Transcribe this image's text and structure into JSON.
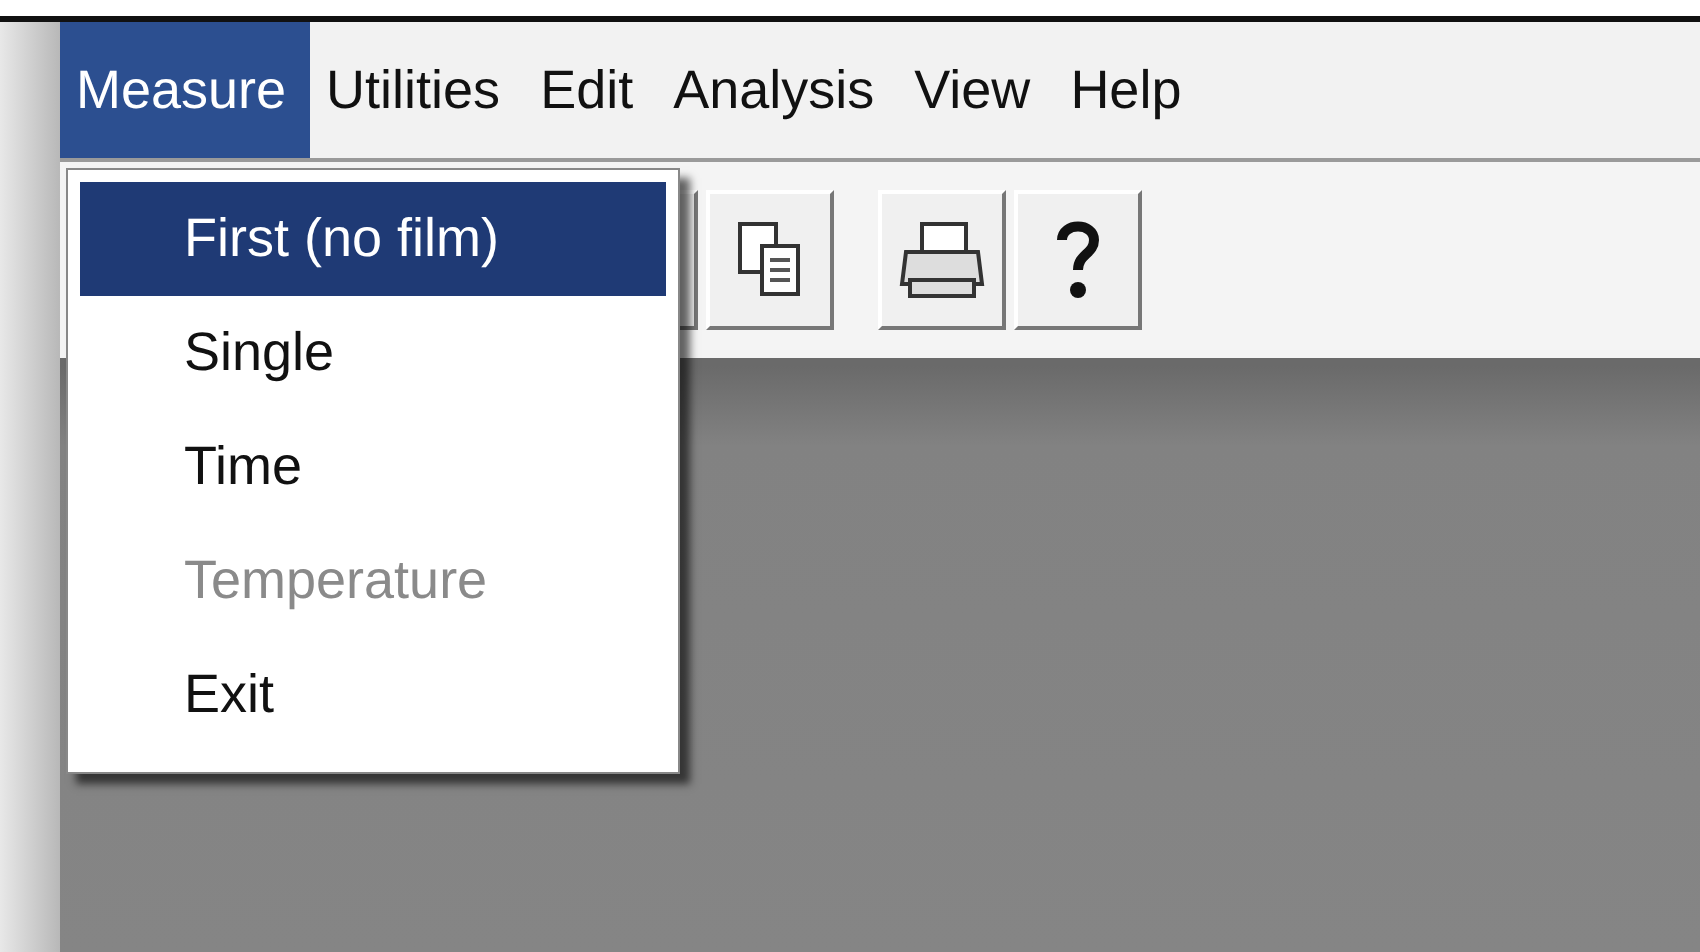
{
  "menu_bar": [
    {
      "label": "Measure",
      "selected": true
    },
    {
      "label": "Utilities",
      "selected": false
    },
    {
      "label": "Edit",
      "selected": false
    },
    {
      "label": "Analysis",
      "selected": false
    },
    {
      "label": "View",
      "selected": false
    },
    {
      "label": "Help",
      "selected": false
    }
  ],
  "dropdown": [
    {
      "label": "First (no film)",
      "selected": true,
      "disabled": false
    },
    {
      "label": "Single",
      "selected": false,
      "disabled": false
    },
    {
      "label": "Time",
      "selected": false,
      "disabled": false
    },
    {
      "label": "Temperature",
      "selected": false,
      "disabled": true
    },
    {
      "label": "Exit",
      "selected": false,
      "disabled": false
    }
  ]
}
